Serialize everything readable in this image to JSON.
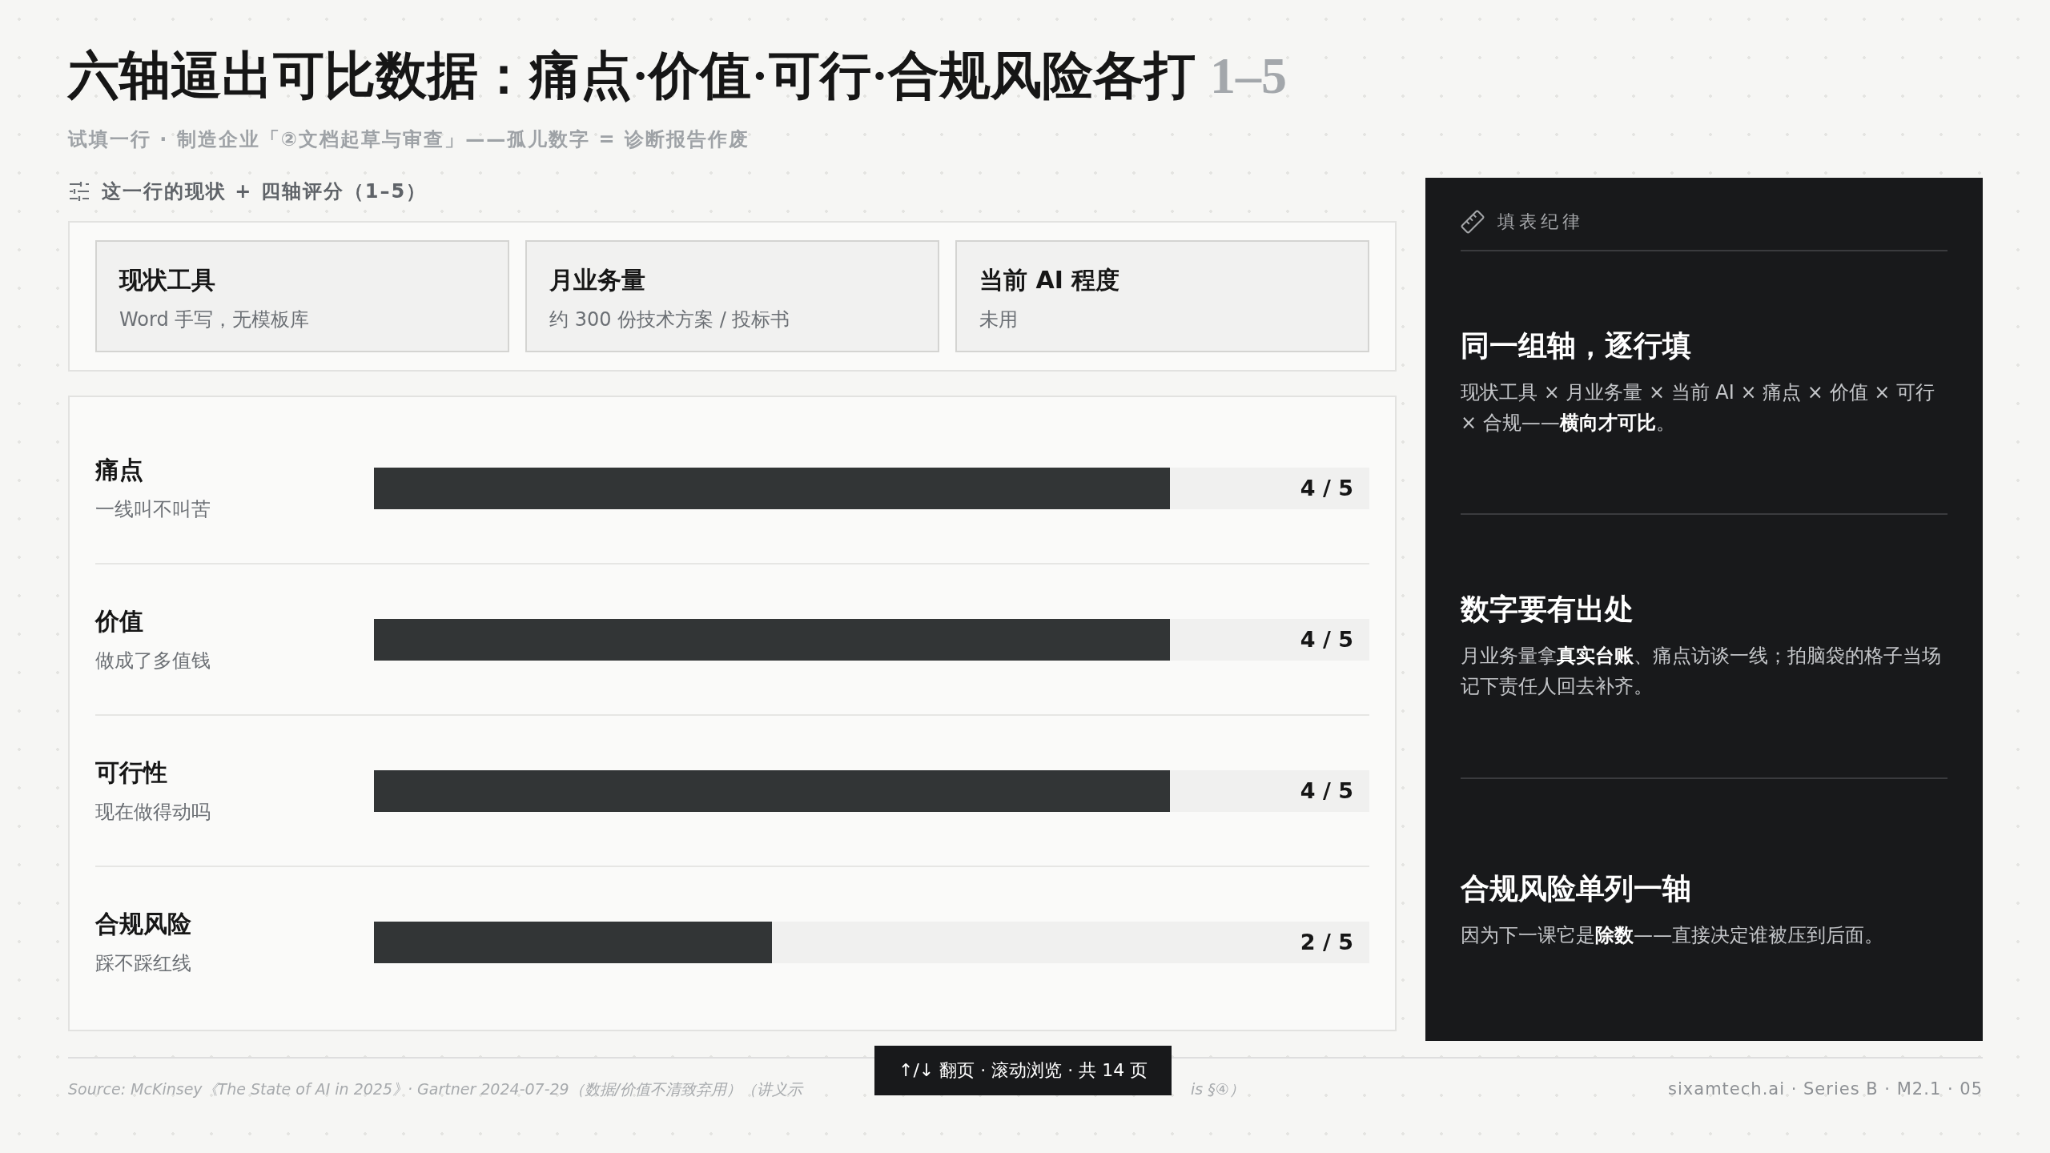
{
  "title": {
    "main": "六轴逼出可比数据：痛点·价值·可行·合规风险各打",
    "range": "1–5"
  },
  "subtitle": "试填一行 · 制造企业「②文档起草与审查」——孤儿数字 = 诊断报告作废",
  "section_label": "这一行的现状 + 四轴评分（1–5）",
  "cards": [
    {
      "title": "现状工具",
      "value": "Word 手写，无模板库"
    },
    {
      "title": "月业务量",
      "value": "约 300 份技术方案 / 投标书"
    },
    {
      "title": "当前 AI 程度",
      "value": "未用"
    }
  ],
  "scores": [
    {
      "name": "痛点",
      "hint": "一线叫不叫苦",
      "level": 0.8,
      "reading": "4 / 5"
    },
    {
      "name": "价值",
      "hint": "做成了多值钱",
      "level": 0.8,
      "reading": "4 / 5"
    },
    {
      "name": "可行性",
      "hint": "现在做得动吗",
      "level": 0.8,
      "reading": "4 / 5"
    },
    {
      "name": "合规风险",
      "hint": "踩不踩红线",
      "level": 0.4,
      "reading": "2 / 5"
    }
  ],
  "rules_panel": {
    "label": "填表纪律",
    "items": [
      {
        "heading": "同一组轴，逐行填",
        "body": "现状工具 × 月业务量 × 当前 AI × 痛点 × 价值 × 可行 × 合规——**横向才可比**。"
      },
      {
        "heading": "数字要有出处",
        "body": "月业务量拿**真实台账**、痛点访谈一线；拍脑袋的格子当场记下责任人回去补齐。"
      },
      {
        "heading": "合规风险单列一轴",
        "body": "因为下一课它是**除数**——直接决定谁被压到后面。"
      }
    ]
  },
  "footer": {
    "source_start": "Source: McKinsey《The State of AI in 2025》· Gartner 2024-07-29（数据/价值不清致弃用）（讲义示",
    "source_end": "is §④）",
    "credit": "sixamtech.ai · Series B · M2.1 · 05"
  },
  "toast": "↑/↓ 翻页 · 滚动浏览 · 共 14 页"
}
